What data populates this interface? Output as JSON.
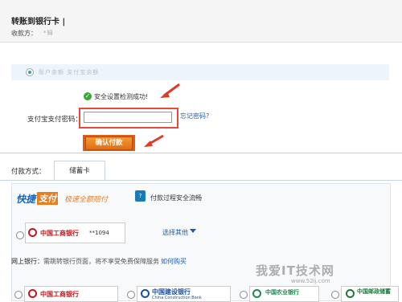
{
  "header": {
    "title": "转账到银行卡 |",
    "payee_label": "收款方：",
    "payee_value": "*姆"
  },
  "account_strip": {
    "text": "账户余额 支付宝余额"
  },
  "security": {
    "ok_text": "安全设置检测成功!"
  },
  "password": {
    "label": "支付宝支付密码：",
    "value": "",
    "forgot_link": "忘记密码?"
  },
  "pay_button": {
    "label": "确认付款"
  },
  "payment": {
    "method_label": "付款方式：",
    "tab_debit": "储蓄卡"
  },
  "express": {
    "logo_part1": "快捷",
    "logo_part2": "支付",
    "tagline": "极速全额赔付",
    "flow_icon": "?",
    "flow_link": "付款过程安全流畅"
  },
  "selected_card": {
    "bank": "中国工商银行",
    "tail": "**1094",
    "choose_other": "选择其他"
  },
  "online_banking": {
    "label": "网上银行：",
    "note": "需跳转银行页面，将不享受免费保障服务",
    "howto_link": "如何购买"
  },
  "banks": [
    {
      "name": "中国工商银行",
      "sub": ""
    },
    {
      "name": "中国建设银行",
      "sub": "China Construction Bank"
    },
    {
      "name": "中国农业银行",
      "sub": ""
    },
    {
      "name": "中国邮政储蓄",
      "sub": ""
    }
  ],
  "watermark": {
    "text": "我爱IT技术网",
    "url": "www.52ij.com"
  },
  "colors": {
    "highlight_red": "#e64a3c",
    "pay_orange": "#e06d16",
    "link_blue": "#1a5fb4",
    "success_green": "#3aa53a"
  },
  "icons": [
    "check-circle-icon",
    "red-arrow-icon",
    "flow-info-icon",
    "chevron-down-icon",
    "bank-emblem-icon"
  ]
}
